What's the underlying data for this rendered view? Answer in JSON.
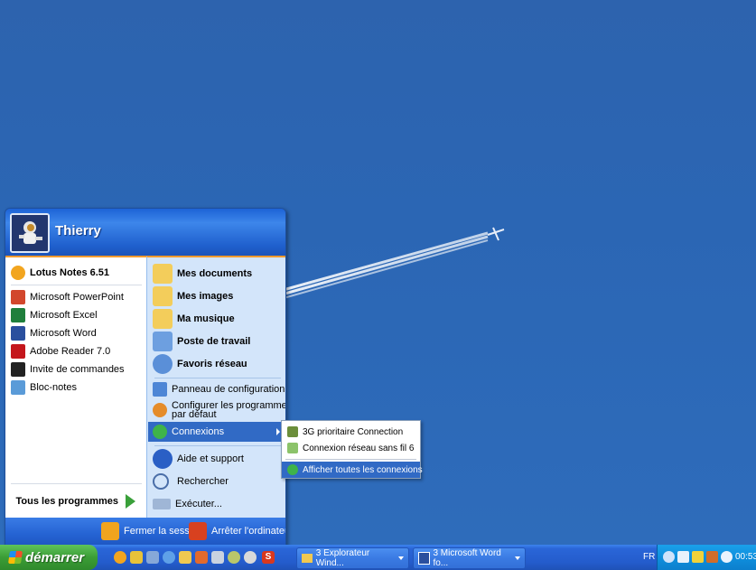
{
  "user": {
    "name": "Thierry"
  },
  "pinned": [
    {
      "label": "Lotus Notes 6.51",
      "icon": "lotus-notes-icon",
      "color": "#f2a51f"
    }
  ],
  "recent": [
    {
      "label": "Microsoft PowerPoint",
      "icon": "powerpoint-icon",
      "color": "#d2472c"
    },
    {
      "label": "Microsoft Excel",
      "icon": "excel-icon",
      "color": "#1f7f3c"
    },
    {
      "label": "Microsoft Word",
      "icon": "word-icon",
      "color": "#2a4f9e"
    },
    {
      "label": "Adobe Reader 7.0",
      "icon": "adobe-reader-icon",
      "color": "#c4161c"
    },
    {
      "label": "Invite de commandes",
      "icon": "command-prompt-icon",
      "color": "#222222"
    },
    {
      "label": "Bloc-notes",
      "icon": "notepad-icon",
      "color": "#5a9bd8"
    }
  ],
  "all_programs": "Tous les programmes",
  "places": [
    {
      "label": "Mes documents",
      "icon": "my-documents-icon"
    },
    {
      "label": "Mes images",
      "icon": "my-pictures-icon"
    },
    {
      "label": "Ma musique",
      "icon": "my-music-icon"
    },
    {
      "label": "Poste de travail",
      "icon": "my-computer-icon"
    },
    {
      "label": "Favoris réseau",
      "icon": "network-places-icon"
    }
  ],
  "settings": {
    "control_panel": "Panneau de configuration",
    "default_programs_1": "Configurer les programmes",
    "default_programs_2": "par défaut",
    "connections": "Connexions"
  },
  "help": {
    "help": "Aide et support",
    "search": "Rechercher",
    "run": "Exécuter..."
  },
  "footer": {
    "logoff": "Fermer la session",
    "shutdown": "Arrêter l'ordinateur"
  },
  "submenu": {
    "items": [
      "3G prioritaire Connection",
      "Connexion réseau sans fil 6"
    ],
    "show_all": "Afficher toutes les connexions"
  },
  "taskbar": {
    "start": "démarrer",
    "buttons": [
      "3 Explorateur Wind...",
      "3 Microsoft Word fo..."
    ],
    "language": "FR",
    "clock": "00:53"
  },
  "colors": {
    "start_green": "#3b9d36",
    "taskbar_blue": "#245ccc",
    "highlight": "#316ac5",
    "accent_orange": "#f29a2e"
  }
}
